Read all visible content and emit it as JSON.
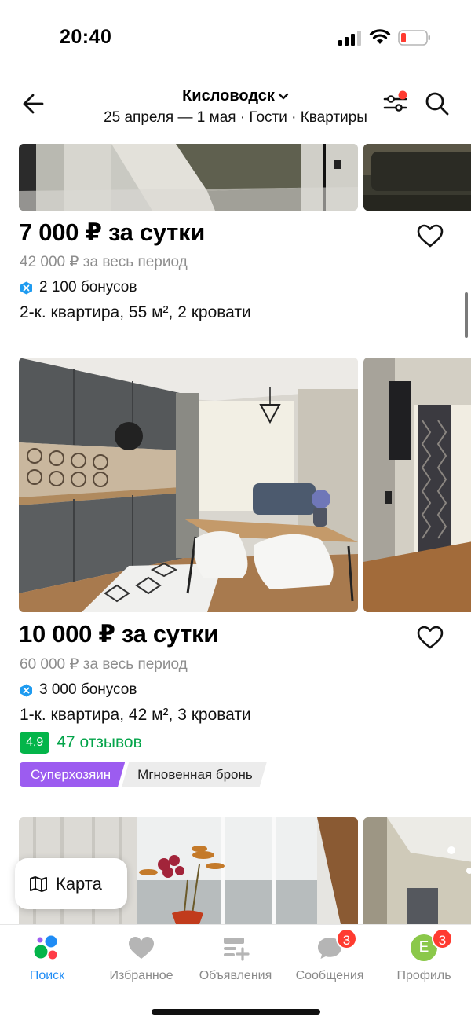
{
  "status_bar": {
    "time": "20:40"
  },
  "header": {
    "city": "Кисловодск",
    "subtitle": "25 апреля — 1 мая · Гости · Квартиры"
  },
  "listings": [
    {
      "price": "7 000 ₽ за сутки",
      "period_total": "42 000 ₽ за весь период",
      "bonus": "2 100 бонусов",
      "description": "2-к. квартира, 55 м², 2 кровати"
    },
    {
      "price": "10 000 ₽ за сутки",
      "period_total": "60 000 ₽ за весь период",
      "bonus": "3 000 бонусов",
      "description": "1-к. квартира, 42 м², 3 кровати",
      "rating": "4,9",
      "reviews": "47 отзывов",
      "badges": [
        "Суперхозяин",
        "Мгновенная бронь"
      ]
    }
  ],
  "map_button": {
    "label": "Карта"
  },
  "tabbar": {
    "items": [
      {
        "label": "Поиск",
        "active": true
      },
      {
        "label": "Избранное"
      },
      {
        "label": "Объявления"
      },
      {
        "label": "Сообщения",
        "badge": "3"
      },
      {
        "label": "Профиль",
        "badge": "3",
        "avatar_letter": "Е"
      }
    ]
  },
  "colors": {
    "accent_blue": "#1f8cf5",
    "rating_green": "#04b54a",
    "superhost_purple": "#9c5cf0",
    "notification_red": "#ff3b30",
    "avatar_green": "#8bc84a"
  }
}
